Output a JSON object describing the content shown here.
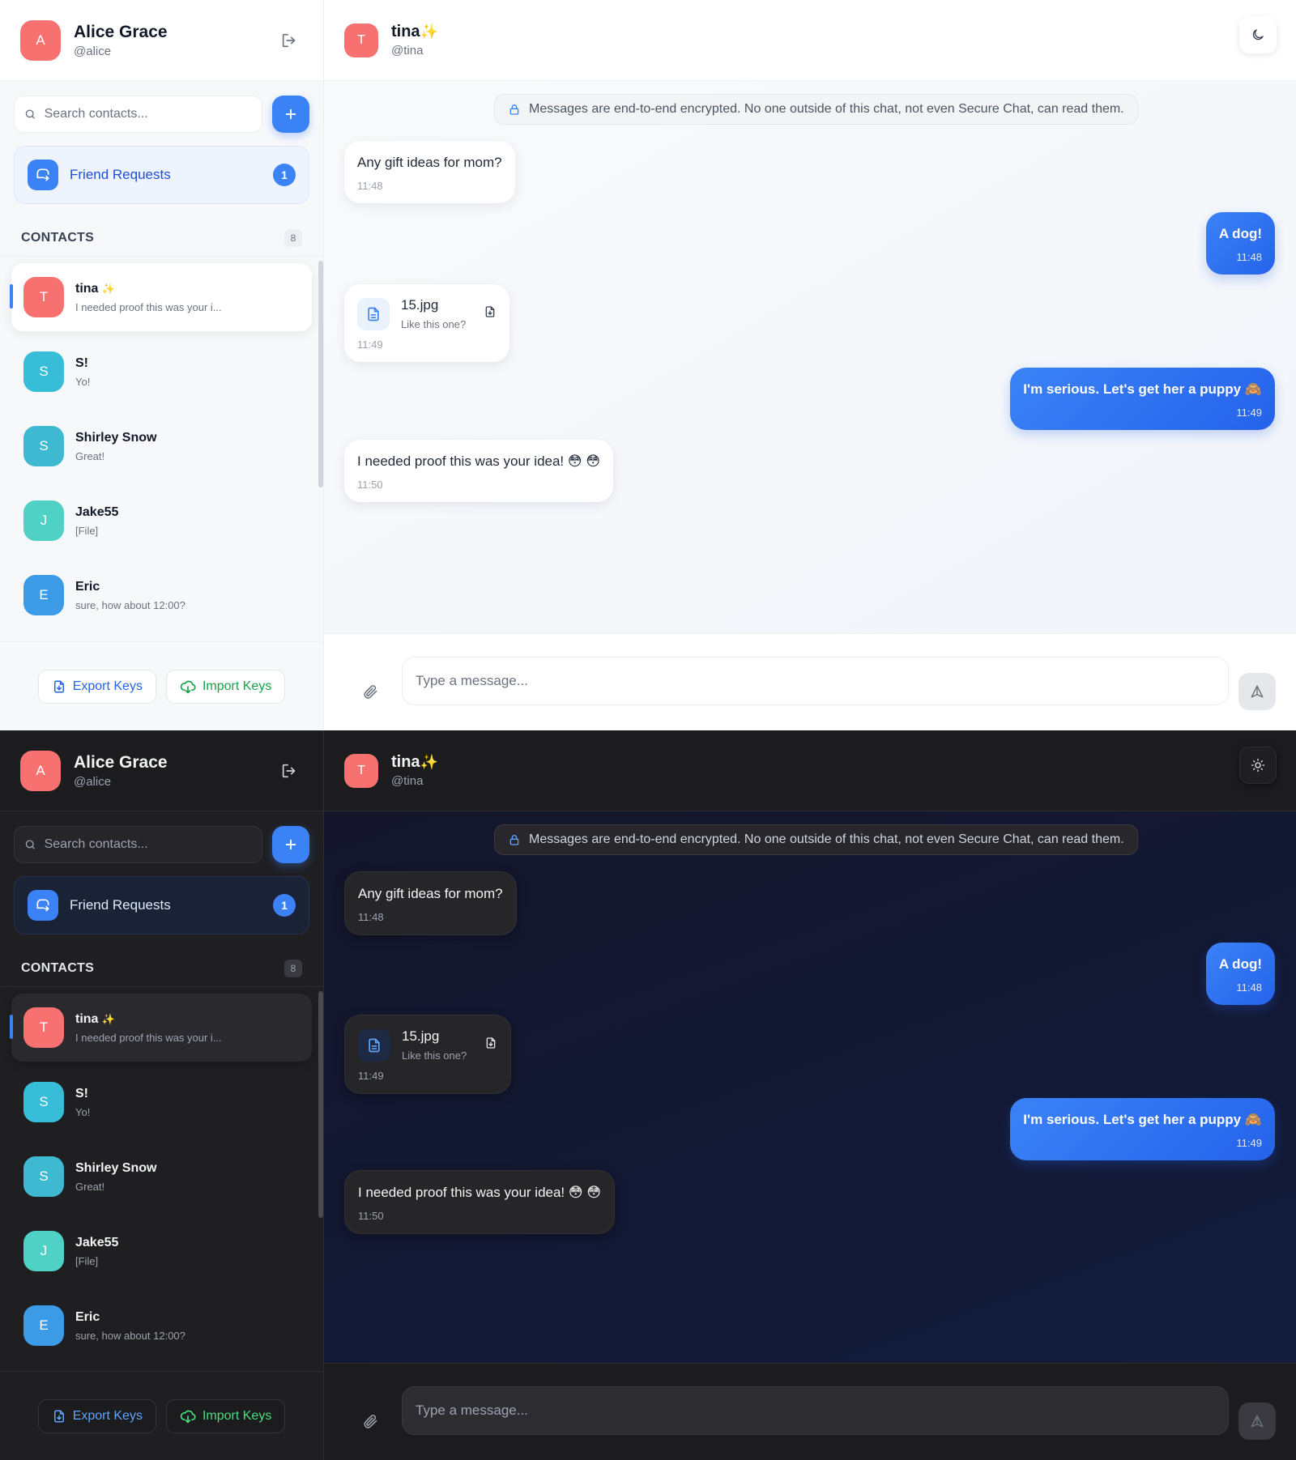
{
  "app": {
    "name": "Secure Chat"
  },
  "user": {
    "avatar_initial": "A",
    "name": "Alice Grace",
    "handle": "@alice"
  },
  "search": {
    "placeholder": "Search contacts..."
  },
  "friend_requests": {
    "label": "Friend Requests",
    "count": "1"
  },
  "contacts": {
    "title": "CONTACTS",
    "count": "8",
    "items": [
      {
        "initial": "T",
        "name": "tina",
        "preview": "I needed proof this was your i...",
        "color": "#f87171",
        "active": true
      },
      {
        "initial": "S",
        "name": "S!",
        "preview": "Yo!",
        "color": "#38bdd8"
      },
      {
        "initial": "S",
        "name": "Shirley Snow",
        "preview": "Great!",
        "color": "#3fb9d1"
      },
      {
        "initial": "J",
        "name": "Jake55",
        "preview": "[File]",
        "color": "#4fd1c5"
      },
      {
        "initial": "E",
        "name": "Eric",
        "preview": "sure, how about 12:00?",
        "color": "#3b9be6"
      }
    ]
  },
  "keys": {
    "export_label": "Export Keys",
    "import_label": "Import Keys"
  },
  "chat": {
    "contact_initial": "T",
    "contact_name": "tina",
    "contact_name_emoji": "✨",
    "contact_handle": "@tina",
    "e2e_notice": "Messages are end-to-end encrypted. No one outside of this chat, not even Secure Chat, can read them.",
    "messages": [
      {
        "direction": "in",
        "text": "Any gift ideas for mom?",
        "time": "11:48"
      },
      {
        "direction": "out",
        "text": "A dog!",
        "time": "11:48"
      },
      {
        "direction": "in",
        "type": "file",
        "file_name": "15.jpg",
        "caption": "Like this one?",
        "time": "11:49"
      },
      {
        "direction": "out",
        "text": "I'm serious. Let's get her a puppy 🙈",
        "time": "11:49"
      },
      {
        "direction": "in",
        "text": "I needed proof this was your idea! 😳 😳",
        "time": "11:50"
      }
    ],
    "input_placeholder": "Type a message..."
  },
  "theme": {
    "light_toggle_icon": "moon-icon",
    "dark_toggle_icon": "sun-icon"
  },
  "colors": {
    "accent": "#3b82f6",
    "avatar_user": "#f87171",
    "import": "#16a34a",
    "export": "#2563eb"
  }
}
